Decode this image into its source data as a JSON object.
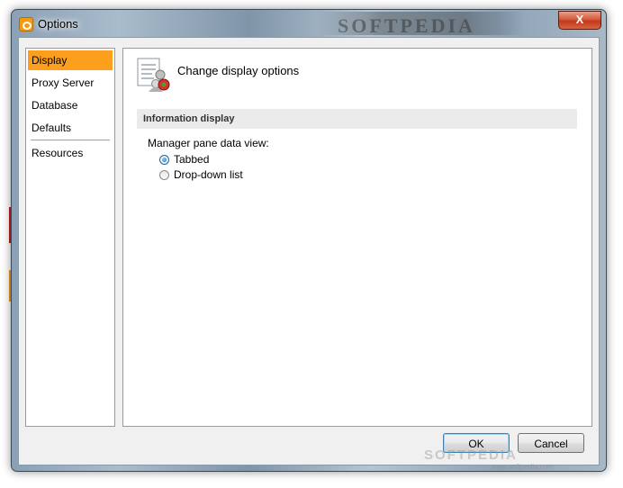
{
  "window": {
    "title": "Options",
    "close_label": "X",
    "watermark": "SOFTPEDIA",
    "watermark_url": "www.softpedia.com"
  },
  "nav": {
    "items": [
      {
        "label": "Display",
        "selected": true
      },
      {
        "label": "Proxy Server",
        "selected": false
      },
      {
        "label": "Database",
        "selected": false
      },
      {
        "label": "Defaults",
        "selected": false
      },
      {
        "label": "Resources",
        "selected": false
      }
    ]
  },
  "panel": {
    "header_title": "Change display options",
    "header_icon": "display-options-icon",
    "section_title": "Information display",
    "field_label": "Manager pane data view:",
    "options": [
      {
        "label": "Tabbed",
        "checked": true
      },
      {
        "label": "Drop-down list",
        "checked": false
      }
    ]
  },
  "buttons": {
    "ok_label": "OK",
    "cancel_label": "Cancel"
  },
  "colors": {
    "selection": "#fb9f1c",
    "section_bar": "#ebebeb",
    "close_button": "#c2381b"
  }
}
